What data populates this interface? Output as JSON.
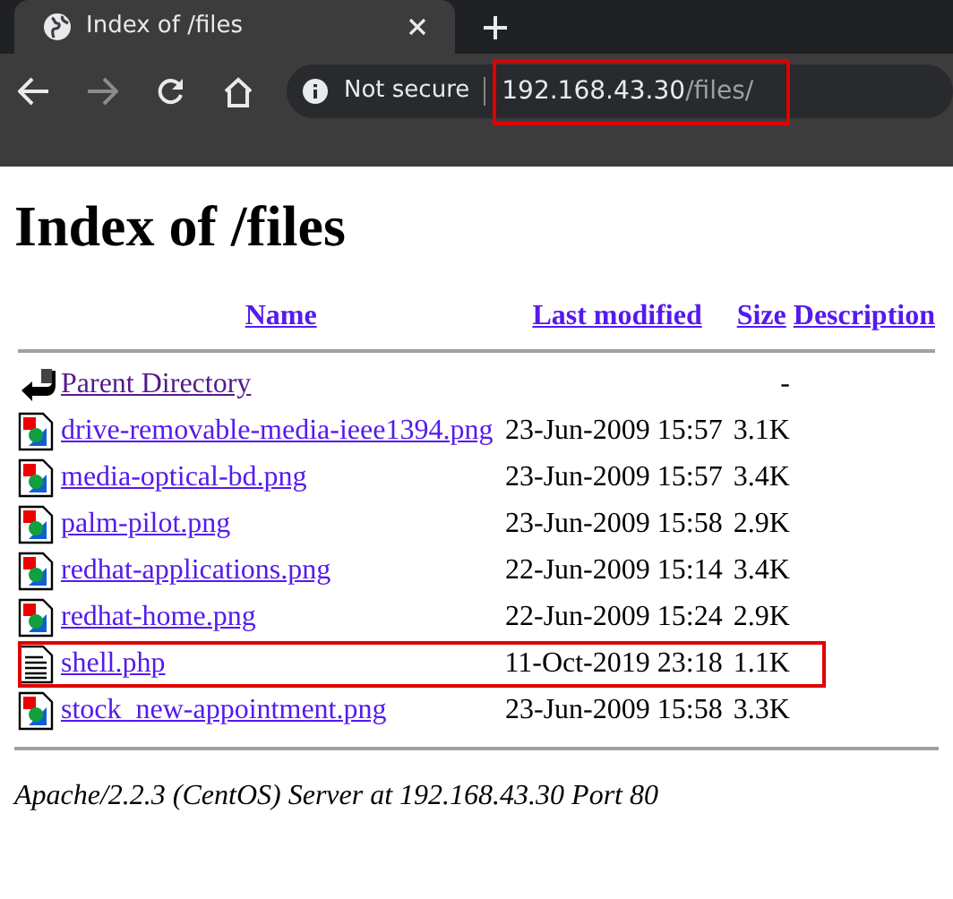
{
  "browser": {
    "tab": {
      "title": "Index of /files",
      "selected": true
    },
    "forward_disabled": true,
    "security": "Not secure",
    "address": {
      "host": "192.168.43.30",
      "path": "/files/",
      "highlighted": true
    }
  },
  "page": {
    "heading": "Index of /files",
    "columns": [
      "Name",
      "Last modified",
      "Size",
      "Description"
    ],
    "rows": [
      {
        "kind": "parent",
        "name": "Parent Directory",
        "size": "-",
        "visited": true,
        "highlighted": false
      },
      {
        "kind": "image",
        "name": "drive-removable-media-ieee1394.png",
        "modified": "23-Jun-2009 15:57",
        "size": "3.1K",
        "visited": false,
        "highlighted": false
      },
      {
        "kind": "image",
        "name": "media-optical-bd.png",
        "modified": "23-Jun-2009 15:57",
        "size": "3.4K",
        "visited": false,
        "highlighted": false
      },
      {
        "kind": "image",
        "name": "palm-pilot.png",
        "modified": "23-Jun-2009 15:58",
        "size": "2.9K",
        "visited": false,
        "highlighted": false
      },
      {
        "kind": "image",
        "name": "redhat-applications.png",
        "modified": "22-Jun-2009 15:14",
        "size": "3.4K",
        "visited": false,
        "highlighted": false
      },
      {
        "kind": "image",
        "name": "redhat-home.png",
        "modified": "22-Jun-2009 15:24",
        "size": "2.9K",
        "visited": false,
        "highlighted": false
      },
      {
        "kind": "text",
        "name": "shell.php",
        "modified": "11-Oct-2019 23:18",
        "size": "1.1K",
        "visited": false,
        "highlighted": true
      },
      {
        "kind": "image",
        "name": "stock_new-appointment.png",
        "modified": "23-Jun-2009 15:58",
        "size": "3.3K",
        "visited": false,
        "highlighted": false
      }
    ],
    "footer": "Apache/2.2.3 (CentOS) Server at 192.168.43.30 Port 80"
  }
}
